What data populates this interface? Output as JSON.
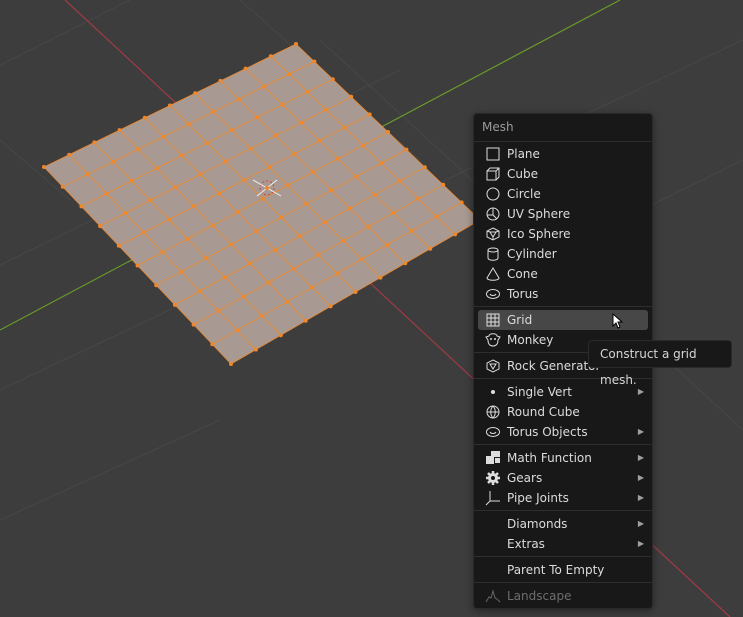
{
  "colors": {
    "background": "#3d3d3d",
    "x_axis": "#a03a46",
    "y_axis": "#6a9a2a",
    "mesh_face": "#a89a92",
    "mesh_edge": "#f0882a",
    "menu_bg": "#181818",
    "highlight": "#474747"
  },
  "menu": {
    "title": "Mesh",
    "items": [
      {
        "label": "Plane",
        "icon": "plane-icon"
      },
      {
        "label": "Cube",
        "icon": "cube-icon"
      },
      {
        "label": "Circle",
        "icon": "circle-icon"
      },
      {
        "label": "UV Sphere",
        "icon": "uv-sphere-icon"
      },
      {
        "label": "Ico Sphere",
        "icon": "ico-sphere-icon"
      },
      {
        "label": "Cylinder",
        "icon": "cylinder-icon"
      },
      {
        "label": "Cone",
        "icon": "cone-icon"
      },
      {
        "label": "Torus",
        "icon": "torus-icon"
      },
      {
        "label": "Grid",
        "icon": "grid-icon",
        "highlighted": true
      },
      {
        "label": "Monkey",
        "icon": "monkey-icon"
      },
      {
        "label": "Rock Generator",
        "icon": "ico-sphere-icon"
      },
      {
        "label": "Single Vert",
        "icon": "dot-icon",
        "submenu": true
      },
      {
        "label": "Round Cube",
        "icon": "sphere-icon"
      },
      {
        "label": "Torus Objects",
        "icon": "torus-icon",
        "submenu": true
      },
      {
        "label": "Math Function",
        "icon": "blocks-icon",
        "submenu": true
      },
      {
        "label": "Gears",
        "icon": "gear-icon",
        "submenu": true
      },
      {
        "label": "Pipe Joints",
        "icon": "pipe-icon",
        "submenu": true
      },
      {
        "label": "Diamonds",
        "submenu": true
      },
      {
        "label": "Extras",
        "submenu": true
      },
      {
        "label": "Parent To Empty"
      },
      {
        "label": "Landscape",
        "icon": "landscape-icon",
        "disabled": true
      }
    ],
    "submenu_arrow": "▶"
  },
  "tooltip": {
    "text": "Construct a grid mesh."
  }
}
